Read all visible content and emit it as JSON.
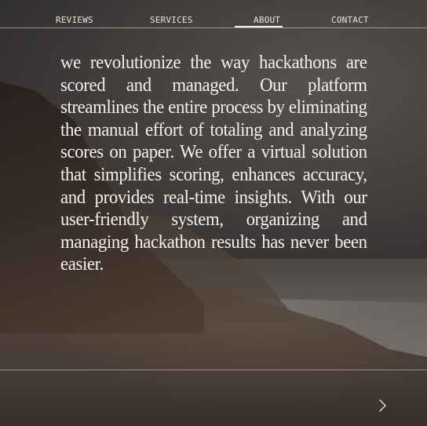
{
  "nav": {
    "items": [
      {
        "label": "REVIEWS"
      },
      {
        "label": "SERVICES"
      },
      {
        "label": "ABOUT",
        "active": true
      },
      {
        "label": "CONTACT"
      }
    ]
  },
  "about": {
    "text": "we revolutionize the way hackathons are scored and managed. Our platform streamlines the entire process by eliminating the manual effort of totaling and analyzing scores on paper. We offer a virtual solution that simplifies scoring, enhances accuracy, and provides real-time insights. With our user-friendly system, organizing and managing hackathon results has never been easier."
  },
  "controls": {
    "next_icon": "chevron-right-icon"
  },
  "colors": {
    "text": "#f4f1ec",
    "divider": "#e1dcd6"
  }
}
